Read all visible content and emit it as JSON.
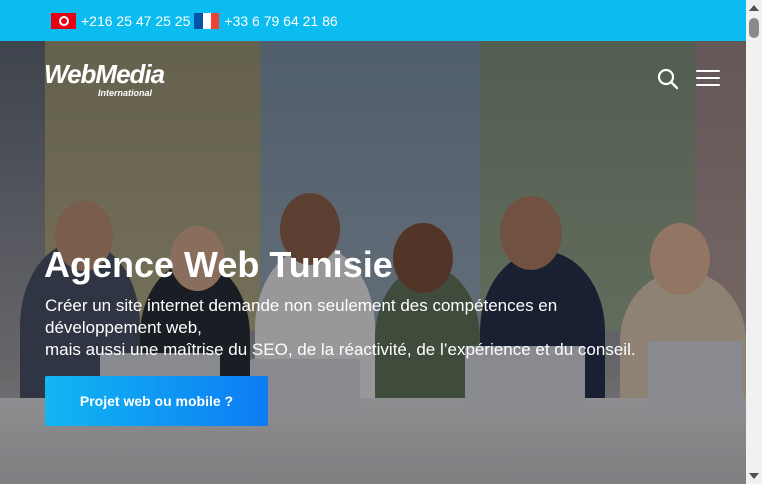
{
  "topbar": {
    "phone_tn": "+216 25 47 25 25",
    "phone_fr": "+33 6 79 64 21 86"
  },
  "header": {
    "logo_main": "WebMedia",
    "logo_sub": "International",
    "icons": [
      "search-icon",
      "hamburger-menu-icon"
    ]
  },
  "hero": {
    "title": "Agence Web Tunisie",
    "line1": "Créer un site internet demande non seulement des compétences en",
    "line2": "développement web,",
    "line3": "mais aussi une maîtrise du SEO, de la réactivité, de l’expérience et du conseil.",
    "cta_label": "Projet web ou mobile ?"
  },
  "colors": {
    "topbar_bg": "#0bbcf0",
    "cta_start": "#12b6f2",
    "cta_end": "#0c7cf4",
    "text": "#ffffff"
  }
}
